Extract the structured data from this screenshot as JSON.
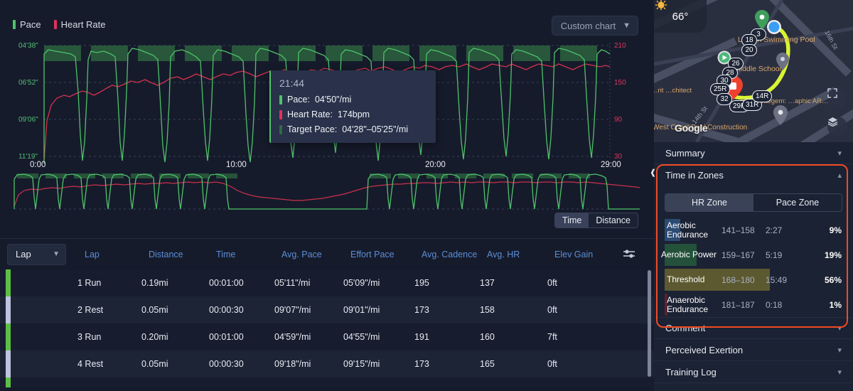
{
  "chart": {
    "legend": [
      {
        "label": "Pace",
        "color": "#4ec26a"
      },
      {
        "label": "Heart Rate",
        "color": "#e0315c"
      }
    ],
    "selector": {
      "label": "Custom chart",
      "chevron": "chevron-down-icon"
    },
    "y_left_ticks": [
      "04'38\"",
      "06'52\"",
      "09'06\"",
      "11'19\""
    ],
    "y_right_ticks": [
      "210",
      "150",
      "90",
      "30"
    ],
    "x_ticks": [
      "0:00",
      "10:00",
      "20:00",
      "29:00"
    ],
    "tooltip": {
      "time": "21:44",
      "rows": [
        {
          "label": "Pace:",
          "value": "04'50\"/mi",
          "color": "#4ec26a"
        },
        {
          "label": "Heart Rate:",
          "value": "174bpm",
          "color": "#e0315c"
        },
        {
          "label": "Target Pace:",
          "value": "04'28\"–05'25\"/mi",
          "color": "#2e6b41"
        }
      ]
    },
    "axis_toggle": {
      "time": "Time",
      "distance": "Distance",
      "selected": "Time"
    }
  },
  "chart_data": {
    "type": "line",
    "title": "",
    "xlabel": "Time",
    "ylabel": "Pace",
    "x_range": [
      "0:00",
      "29:00"
    ],
    "y_left_label": "Pace (/mi)",
    "y_left_range": [
      "04'38\"",
      "11'19\""
    ],
    "y_right_label": "Heart Rate (bpm)",
    "y_right_range": [
      30,
      210
    ],
    "grid": true,
    "legend_position": "top-left",
    "series": [
      {
        "name": "Pace",
        "color": "#4ec26a",
        "unit": "/mi"
      },
      {
        "name": "Heart Rate",
        "color": "#e0315c",
        "unit": "bpm"
      },
      {
        "name": "Target Pace",
        "color": "#2e6b41",
        "range": "04'28\"-05'25\"/mi"
      }
    ],
    "highlighted_point": {
      "x": "21:44",
      "pace": "04'50\"/mi",
      "hr": "174bpm"
    }
  },
  "table": {
    "lap_selector": {
      "label": "Lap",
      "chevron": "chevron-down-icon"
    },
    "filter_icon": "sliders-icon",
    "columns": [
      "Lap",
      "Distance",
      "Time",
      "Avg. Pace",
      "Effort Pace",
      "Avg. Cadence",
      "Avg. HR",
      "Elev Gain"
    ],
    "rows": [
      {
        "lap": "1 Run",
        "distance": "0.19mi",
        "time": "00:01:00",
        "avg_pace": "05'11\"/mi",
        "effort_pace": "05'09\"/mi",
        "avg_cadence": "195",
        "avg_hr": "137",
        "elev_gain": "0ft",
        "bar_color": "#5cbf45"
      },
      {
        "lap": "2 Rest",
        "distance": "0.05mi",
        "time": "00:00:30",
        "avg_pace": "09'07\"/mi",
        "effort_pace": "09'01\"/mi",
        "avg_cadence": "173",
        "avg_hr": "158",
        "elev_gain": "0ft",
        "bar_color": "#bec4e0"
      },
      {
        "lap": "3 Run",
        "distance": "0.20mi",
        "time": "00:01:00",
        "avg_pace": "04'59\"/mi",
        "effort_pace": "04'55\"/mi",
        "avg_cadence": "191",
        "avg_hr": "160",
        "elev_gain": "7ft",
        "bar_color": "#5cbf45"
      },
      {
        "lap": "4 Rest",
        "distance": "0.05mi",
        "time": "00:00:30",
        "avg_pace": "09'18\"/mi",
        "effort_pace": "09'15\"/mi",
        "avg_cadence": "173",
        "avg_hr": "165",
        "elev_gain": "0ft",
        "bar_color": "#bec4e0"
      }
    ]
  },
  "map": {
    "weather": {
      "icon": "sun-icon",
      "temperature": "66°"
    },
    "watermark": "Google",
    "labels": [
      {
        "text": "Lincoln Swimming Pool"
      },
      {
        "text": "Middle School"
      },
      {
        "text": "16th St"
      },
      {
        "text": "14th St"
      },
      {
        "text": "West Coast Pool Construction"
      },
      {
        "text": "Cam…ntegem: …aphic AR…"
      },
      {
        "text": "…rit …chitect"
      }
    ],
    "markers": [
      "3",
      "18",
      "20",
      "26",
      "28",
      "30",
      "25R",
      "32",
      "29R",
      "31R",
      "14R"
    ],
    "controls": [
      {
        "name": "fullscreen-icon"
      },
      {
        "name": "layers-icon"
      }
    ]
  },
  "panel": {
    "summary": {
      "label": "Summary",
      "chevron": "chevron-down-icon"
    },
    "time_in_zones": {
      "label": "Time in Zones",
      "chevron": "chevron-up-icon",
      "tabs": [
        {
          "label": "HR Zone",
          "selected": true
        },
        {
          "label": "Pace Zone",
          "selected": false
        }
      ],
      "zones": [
        {
          "name": "Aerobic Endurance",
          "range": "141–158",
          "time": "2:27",
          "percent": "9%",
          "color": "#2c4b73",
          "width": 9
        },
        {
          "name": "Aerobic Power",
          "range": "159–167",
          "time": "5:19",
          "percent": "19%",
          "color": "#24513a",
          "width": 19
        },
        {
          "name": "Threshold",
          "range": "168–180",
          "time": "15:49",
          "percent": "56%",
          "color": "#5c5930",
          "width": 56
        },
        {
          "name": "Anaerobic Endurance",
          "range": "181–187",
          "time": "0:18",
          "percent": "1%",
          "color": "#5a2230",
          "width": 1
        }
      ]
    },
    "comment": {
      "label": "Comment",
      "chevron": "chevron-down-icon"
    },
    "perceived_exertion": {
      "label": "Perceived Exertion",
      "chevron": "chevron-down-icon"
    },
    "training_log": {
      "label": "Training Log",
      "chevron": "chevron-down-icon"
    },
    "highlight_color": "#f04a23"
  }
}
